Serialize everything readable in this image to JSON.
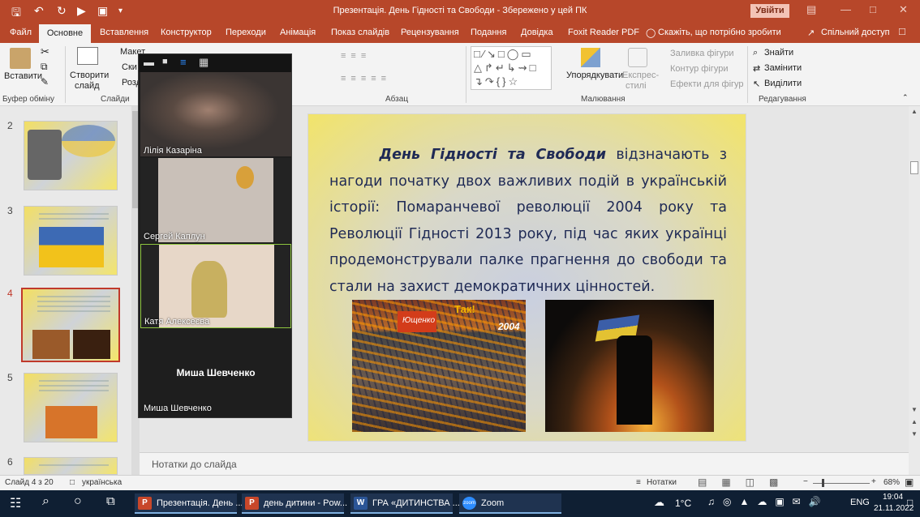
{
  "title_bar": {
    "title": "Презентація. День Гідності та Свободи  -  Збережено у цей ПК",
    "signin": "Увійти"
  },
  "menu": {
    "tabs": [
      "Файл",
      "Основне",
      "Вставлення",
      "Конструктор",
      "Переходи",
      "Анімація",
      "Показ слайдів",
      "Рецензування",
      "Подання",
      "Довідка",
      "Foxit Reader PDF",
      "Скажіть, що потрібно зробити"
    ],
    "share": "Спільний доступ"
  },
  "ribbon": {
    "paste": "Вставити",
    "clipboard": "Буфер обміну",
    "new_slide": "Створити",
    "new_slide2": "слайд",
    "slides_group": "Слайди",
    "layout": "Макет",
    "reset": "Ски",
    "section": "Розд",
    "paragraph": "Абзац",
    "arrange": "Упорядкувати",
    "quick_styles": "Експрес-",
    "quick_styles2": "стилі",
    "fill": "Заливка фігури",
    "outline": "Контур фігури",
    "effects": "Ефекти для фігур",
    "drawing": "Малювання",
    "find": "Знайти",
    "replace": "Замінити",
    "select": "Виділити",
    "editing": "Редагування"
  },
  "thumbnails": [
    {
      "n": "2"
    },
    {
      "n": "3"
    },
    {
      "n": "4"
    },
    {
      "n": "5"
    },
    {
      "n": "6"
    }
  ],
  "slide": {
    "bold_lead": "День Гідності та Свободи",
    "body": " відзначають з нагоди початку двох важливих подій в українській історії: Помаранчевої революції 2004 року та Революції Гідності 2013 року, під час яких українці продемонстрували палке прагнення до свободи та стали на захист демократичних цінностей.",
    "photo1_labels": [
      "Ющенко",
      "Так!",
      "2004"
    ]
  },
  "notes": {
    "placeholder": "Нотатки до слайда"
  },
  "status": {
    "slide": "Слайд 4 з 20",
    "lang": "українська",
    "notes": "Нотатки",
    "zoom": "68%"
  },
  "zoom_call": {
    "participants": [
      {
        "name": "Лілія Казаріна"
      },
      {
        "name": "Сергей Каплун"
      },
      {
        "name": "Катя Алексеєва"
      },
      {
        "name": "Миша Шевченко"
      }
    ],
    "big_name": "Миша Шевченко"
  },
  "taskbar": {
    "apps": [
      {
        "label": "Презентація. День ...",
        "icon": "P"
      },
      {
        "label": "день дитини - Pow...",
        "icon": "P"
      },
      {
        "label": "ГРА «ДИТИНСТВА ...",
        "icon": "W"
      },
      {
        "label": "Zoom",
        "icon": "zoom"
      }
    ],
    "weather": "1°C",
    "lang": "ENG",
    "time": "19:04",
    "date": "21.11.2022"
  },
  "colors": {
    "accent": "#b7472a",
    "taskbar": "#0f1f33",
    "selected_thumb": "#c0392b",
    "slide_text": "#1f2a55"
  }
}
